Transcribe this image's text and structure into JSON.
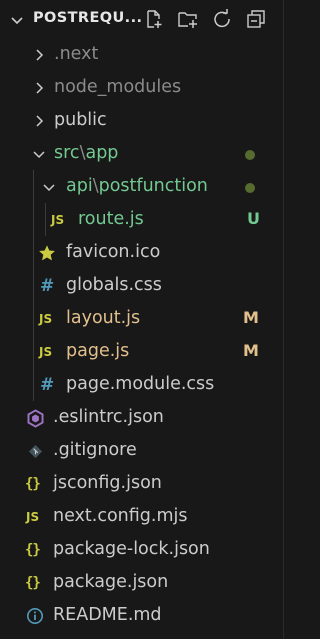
{
  "explorer": {
    "title": "POSTREQU...",
    "actions": [
      "new-file-icon",
      "new-folder-icon",
      "refresh-icon",
      "collapse-all-icon"
    ]
  },
  "colors": {
    "background": "#181818",
    "untracked": "#73c991",
    "modified": "#e2c08d",
    "dot": "#556b2f",
    "muted": "#8b8b8b"
  },
  "tree": [
    {
      "name": ".next",
      "type": "folder",
      "expanded": false,
      "color": "#8b8b8b"
    },
    {
      "name": "node_modules",
      "type": "folder",
      "expanded": false,
      "color": "#8b8b8b"
    },
    {
      "name": "public",
      "type": "folder",
      "expanded": false,
      "color": "#cccccc"
    },
    {
      "name_parts": [
        "src",
        "\\",
        "app"
      ],
      "type": "folder",
      "expanded": true,
      "color": "#73c991",
      "decoration": "dot"
    },
    {
      "name_parts": [
        "api",
        "\\",
        "postfunction"
      ],
      "type": "folder",
      "expanded": true,
      "color": "#73c991",
      "decoration": "dot"
    },
    {
      "name": "route.js",
      "type": "file",
      "icon": "JS",
      "color": "#73c991",
      "badge": "U"
    },
    {
      "name": "favicon.ico",
      "type": "file",
      "icon": "star-icon",
      "color": "#cccccc"
    },
    {
      "name": "globals.css",
      "type": "file",
      "icon": "#",
      "color": "#cccccc"
    },
    {
      "name": "layout.js",
      "type": "file",
      "icon": "JS",
      "color": "#e2c08d",
      "badge": "M"
    },
    {
      "name": "page.js",
      "type": "file",
      "icon": "JS",
      "color": "#e2c08d",
      "badge": "M"
    },
    {
      "name": "page.module.css",
      "type": "file",
      "icon": "#",
      "color": "#cccccc"
    },
    {
      "name": ".eslintrc.json",
      "type": "file",
      "icon": "eslint-icon",
      "color": "#cccccc"
    },
    {
      "name": ".gitignore",
      "type": "file",
      "icon": "git-icon",
      "color": "#cccccc"
    },
    {
      "name": "jsconfig.json",
      "type": "file",
      "icon": "{}",
      "color": "#cccccc"
    },
    {
      "name": "next.config.mjs",
      "type": "file",
      "icon": "JS",
      "color": "#cccccc"
    },
    {
      "name": "package-lock.json",
      "type": "file",
      "icon": "{}",
      "color": "#cccccc"
    },
    {
      "name": "package.json",
      "type": "file",
      "icon": "{}",
      "color": "#cccccc"
    },
    {
      "name": "README.md",
      "type": "file",
      "icon": "info-icon",
      "color": "#cccccc"
    }
  ]
}
